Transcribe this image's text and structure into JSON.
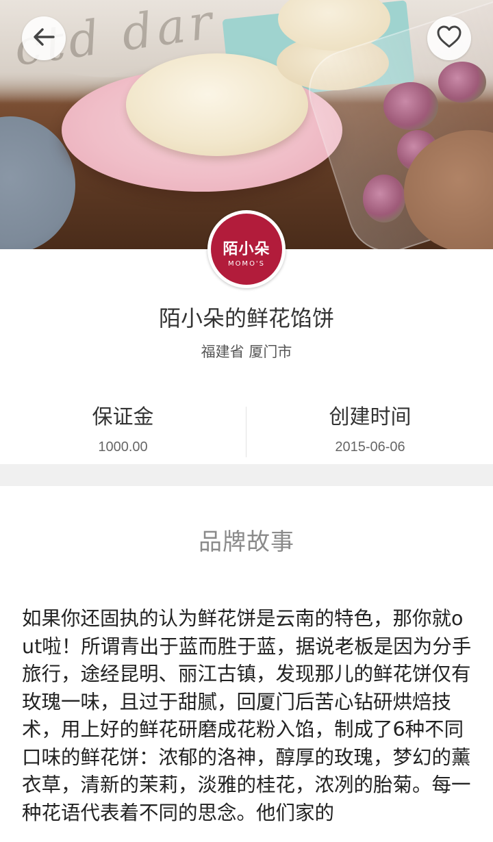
{
  "header": {
    "back_icon": "back-arrow-icon",
    "favorite_icon": "heart-outline-icon"
  },
  "logo": {
    "main_text": "陌小朵",
    "sub_text": "MOMO'S",
    "color": "#b21c3b"
  },
  "shop": {
    "name": "陌小朵的鲜花馅饼",
    "location": "福建省 厦门市"
  },
  "stats": {
    "deposit_label": "保证金",
    "deposit_value": "1000.00",
    "created_label": "创建时间",
    "created_value": "2015-06-06"
  },
  "story": {
    "title": "品牌故事",
    "body": "如果你还固执的认为鲜花饼是云南的特色，那你就out啦！所谓青出于蓝而胜于蓝，据说老板是因为分手旅行，途经昆明、丽江古镇，发现那儿的鲜花饼仅有玫瑰一味，且过于甜腻，回厦门后苦心钻研烘焙技术，用上好的鲜花研磨成花粉入馅，制成了6种不同口味的鲜花饼：浓郁的洛神，醇厚的玫瑰，梦幻的薰衣草，清新的茉莉，淡雅的桂花，浓冽的胎菊。每一种花语代表着不同的思念。他们家的"
  }
}
